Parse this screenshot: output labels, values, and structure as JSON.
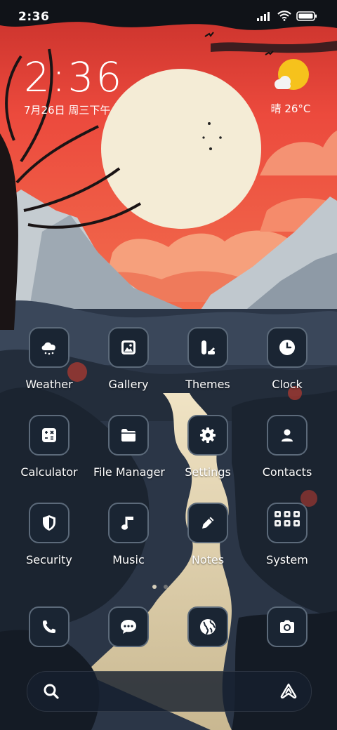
{
  "status_bar": {
    "time": "2:36",
    "icons": [
      "signal-icon",
      "wifi-icon",
      "battery-icon"
    ]
  },
  "clock_widget": {
    "time": "2:36",
    "date": "7月26日 周三下午"
  },
  "weather_widget": {
    "icon": "sun-cloud-icon",
    "text": "晴 26°C"
  },
  "apps": [
    {
      "label": "Weather",
      "icon": "weather-cloud-icon"
    },
    {
      "label": "Gallery",
      "icon": "gallery-icon"
    },
    {
      "label": "Themes",
      "icon": "themes-icon"
    },
    {
      "label": "Clock",
      "icon": "clock-icon"
    },
    {
      "label": "Calculator",
      "icon": "calculator-icon"
    },
    {
      "label": "File Manager",
      "icon": "folder-icon"
    },
    {
      "label": "Settings",
      "icon": "gear-icon"
    },
    {
      "label": "Contacts",
      "icon": "contact-icon"
    },
    {
      "label": "Security",
      "icon": "shield-icon"
    },
    {
      "label": "Music",
      "icon": "music-note-icon"
    },
    {
      "label": "Notes",
      "icon": "pencil-icon"
    },
    {
      "label": "System",
      "icon": "folder-grid-icon"
    }
  ],
  "dock": [
    {
      "icon": "phone-icon"
    },
    {
      "icon": "message-icon"
    },
    {
      "icon": "globe-icon"
    },
    {
      "icon": "camera-icon"
    }
  ],
  "search_bar": {
    "left_icon": "search-icon",
    "right_icon": "assistant-icon"
  },
  "colors": {
    "sky_red": "#e8443a",
    "moon": "#f4ecd6",
    "sun": "#f6c21c",
    "icon_bg": "#1a2533",
    "icon_border": "#5c6a7a",
    "night": "#0f1620"
  }
}
